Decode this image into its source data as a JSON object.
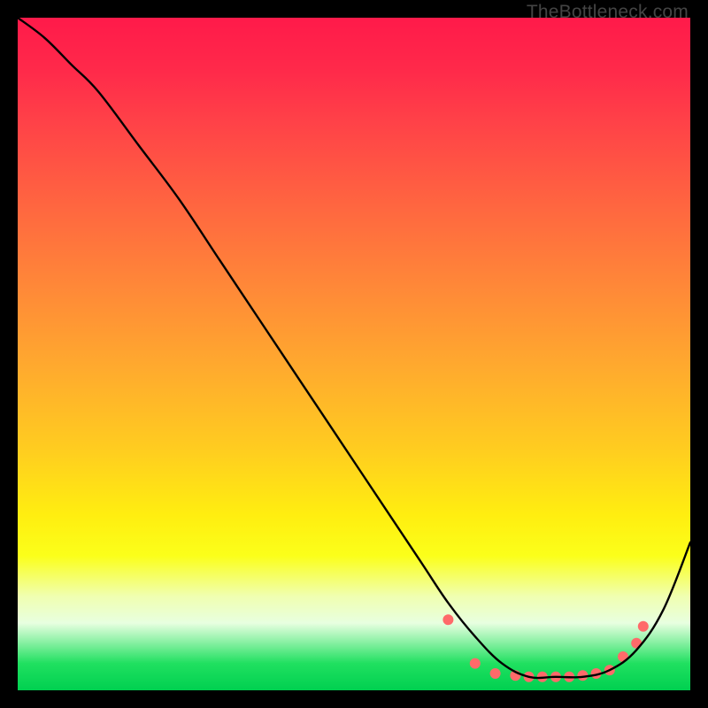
{
  "watermark": "TheBottleneck.com",
  "chart_data": {
    "type": "line",
    "title": "",
    "xlabel": "",
    "ylabel": "",
    "xlim": [
      0,
      100
    ],
    "ylim": [
      0,
      100
    ],
    "series": [
      {
        "name": "curve",
        "x": [
          0,
          4,
          8,
          12,
          18,
          24,
          30,
          36,
          42,
          48,
          54,
          60,
          64,
          68,
          72,
          76,
          80,
          84,
          88,
          92,
          96,
          100
        ],
        "y": [
          100,
          97,
          93,
          89,
          81,
          73,
          64,
          55,
          46,
          37,
          28,
          19,
          13,
          8,
          4,
          2,
          2,
          2,
          3,
          6,
          12,
          22
        ],
        "stroke": "#000000",
        "width": 2.4
      }
    ],
    "markers": {
      "name": "dots",
      "x": [
        64,
        68,
        71,
        74,
        76,
        78,
        80,
        82,
        84,
        86,
        88,
        90,
        92,
        93
      ],
      "y": [
        10.5,
        4.0,
        2.5,
        2.2,
        2.0,
        2.0,
        2.0,
        2.0,
        2.2,
        2.5,
        3.0,
        5.0,
        7.0,
        9.5
      ],
      "color": "#ff6a6a",
      "radius": 6
    }
  }
}
